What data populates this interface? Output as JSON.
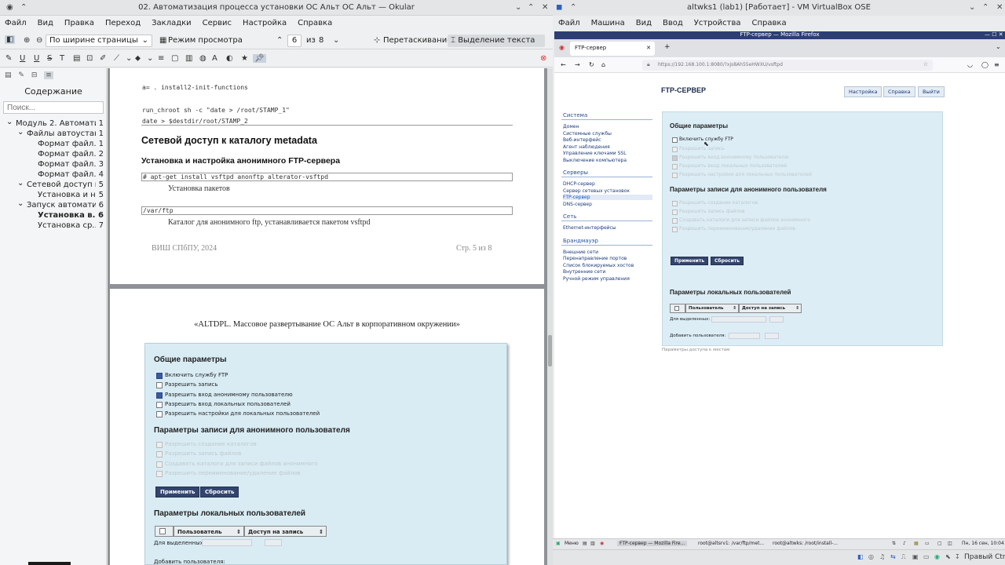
{
  "okular": {
    "title": "02. Автоматизация процесса установки ОС Альт ОС Альт — Okular",
    "menu": [
      "Файл",
      "Вид",
      "Правка",
      "Переход",
      "Закладки",
      "Сервис",
      "Настройка",
      "Справка"
    ],
    "toolbar": {
      "zoom": "По ширине страницы",
      "view_mode": "Режим просмотра",
      "page": "6",
      "of": "из",
      "total": "8",
      "drag": "Перетаскивание",
      "select": "Выделение текста"
    },
    "sidebar": {
      "heading": "Содержание",
      "search_placeholder": "Поиск...",
      "toc": [
        {
          "label": "Модуль 2. Автомати...",
          "page": "1",
          "level": 0,
          "arrow": "⌄"
        },
        {
          "label": "Файлы автоустан...",
          "page": "1",
          "level": 1,
          "arrow": "⌄"
        },
        {
          "label": "Формат файл...",
          "page": "1",
          "level": 2,
          "arrow": ""
        },
        {
          "label": "Формат файл...",
          "page": "2",
          "level": 2,
          "arrow": ""
        },
        {
          "label": "Формат файл...",
          "page": "3",
          "level": 2,
          "arrow": ""
        },
        {
          "label": "Формат файл...",
          "page": "4",
          "level": 2,
          "arrow": ""
        },
        {
          "label": "Сетевой доступ к...",
          "page": "5",
          "level": 1,
          "arrow": "⌄"
        },
        {
          "label": "Установка и н...",
          "page": "5",
          "level": 2,
          "arrow": ""
        },
        {
          "label": "Запуск автомати...",
          "page": "6",
          "level": 1,
          "arrow": "⌄"
        },
        {
          "label": "Установка в...",
          "page": "6",
          "level": 2,
          "arrow": "",
          "bold": true
        },
        {
          "label": "Установка ср...",
          "page": "7",
          "level": 2,
          "arrow": ""
        }
      ]
    },
    "page1": {
      "code1": "a= . install2-init-functions",
      "code2": "run_chroot sh -c \"date > /root/STAMP_1\"",
      "code3": "date > $destdir/root/STAMP_2",
      "h_section": "Сетевой доступ к каталогу metadata",
      "h_sub": "Установка и настройка анонимного FTP-сервера",
      "cmd": "# apt-get install vsftpd anonftp alterator-vsftpd",
      "cmd_caption": "Установка пакетов",
      "path": "/var/ftp",
      "path_caption": "Каталог для анонимного ftp, устанавливается пакетом vsftpd",
      "footer_left": "ВИШ СПбПУ, 2024",
      "footer_right": "Стр. 5   из 8"
    },
    "page2": {
      "header": "«ALTDPL. Массовое развертывание ОС Альт в корпоративном окружении»",
      "general_title": "Общие параметры",
      "general_opts": [
        {
          "label": "Включить службу FTP",
          "checked": true
        },
        {
          "label": "Разрешить запись",
          "checked": false
        },
        {
          "label": "Разрешить вход анонимному пользователю",
          "checked": true
        },
        {
          "label": "Разрешить вход локальных пользователей",
          "checked": false
        },
        {
          "label": "Разрешить настройки для локальных пользователей",
          "checked": false
        }
      ],
      "anon_title": "Параметры записи для анонимного пользователя",
      "anon_opts": [
        "Разрешить создание каталогов",
        "Разрешить запись файлов",
        "Создавать каталоги для записи файлов анонимного",
        "Разрешить переименование/удаление файлов"
      ],
      "apply": "Применить",
      "reset": "Сбросить",
      "local_title": "Параметры локальных пользователей",
      "col_user": "Пользователь",
      "col_write": "Доступ на запись",
      "for_selected": "Для выделенных:",
      "add_user": "Добавить пользователя:"
    }
  },
  "vbox": {
    "title": "altwks1 (lab1) [Работает] - VM VirtualBox OSE",
    "menu": [
      "Файл",
      "Машина",
      "Вид",
      "Ввод",
      "Устройства",
      "Справка"
    ],
    "firefox": {
      "window_title": "FTP-сервер — Mozilla Firefox",
      "tab": "FTP-сервер",
      "url": "https://192.168.100.1:8080/?xjs8Ah55eHWXU/vsftpd",
      "page_title": "FTP-СЕРВЕР",
      "top_buttons": [
        "Настройка",
        "Справка",
        "Выйти"
      ],
      "nav": [
        {
          "section": "Система",
          "items": [
            "Домен",
            "Системные службы",
            "Веб-интерфейс",
            "Агент наблюдения",
            "Управление ключами SSL",
            "Выключение компьютера"
          ]
        },
        {
          "section": "Серверы",
          "items": [
            "DHCP-сервер",
            "Сервер сетевых установок",
            "FTP-сервер",
            "DNS-сервер"
          ]
        },
        {
          "section": "Сеть",
          "items": [
            "Ethernet-интерфейсы"
          ]
        },
        {
          "section": "Брандмауэр",
          "items": [
            "Внешние сети",
            "Перенаправление портов",
            "Список блокируемых хостов",
            "Внутренние сети",
            "Ручной режим управления"
          ]
        }
      ],
      "general_title": "Общие параметры",
      "enable_ftp": "Включить службу FTP",
      "dim_opts": [
        "Разрешить запись",
        "Разрешить вход анонимному пользователю",
        "Разрешить вход локальных пользователей",
        "Разрешить настройки для локальных пользователей"
      ],
      "anon_title": "Параметры записи для анонимного пользователя",
      "anon_opts": [
        "Разрешить создание каталогов",
        "Разрешить запись файлов",
        "Создавать каталоги для записи файлов анонимного",
        "Разрешить переименование/удаление файлов"
      ],
      "apply": "Применить",
      "reset": "Сбросить",
      "local_title": "Параметры локальных пользователей",
      "col_user": "Пользователь",
      "col_write": "Доступ на запись",
      "for_selected": "Для выделенных:",
      "add_user": "Добавить пользователя:",
      "footer": "Параметры доступа к местам"
    },
    "taskbar": {
      "menu": "Меню",
      "apps": [
        "FTP-сервер — Mozilla Fire...",
        "root@altsrv1: /var/ftp/met...",
        "root@altwks: /root/install-..."
      ],
      "clock": "Пн, 16 сен, 10:04"
    },
    "status": {
      "host_key": "Правый Ctrl"
    }
  }
}
